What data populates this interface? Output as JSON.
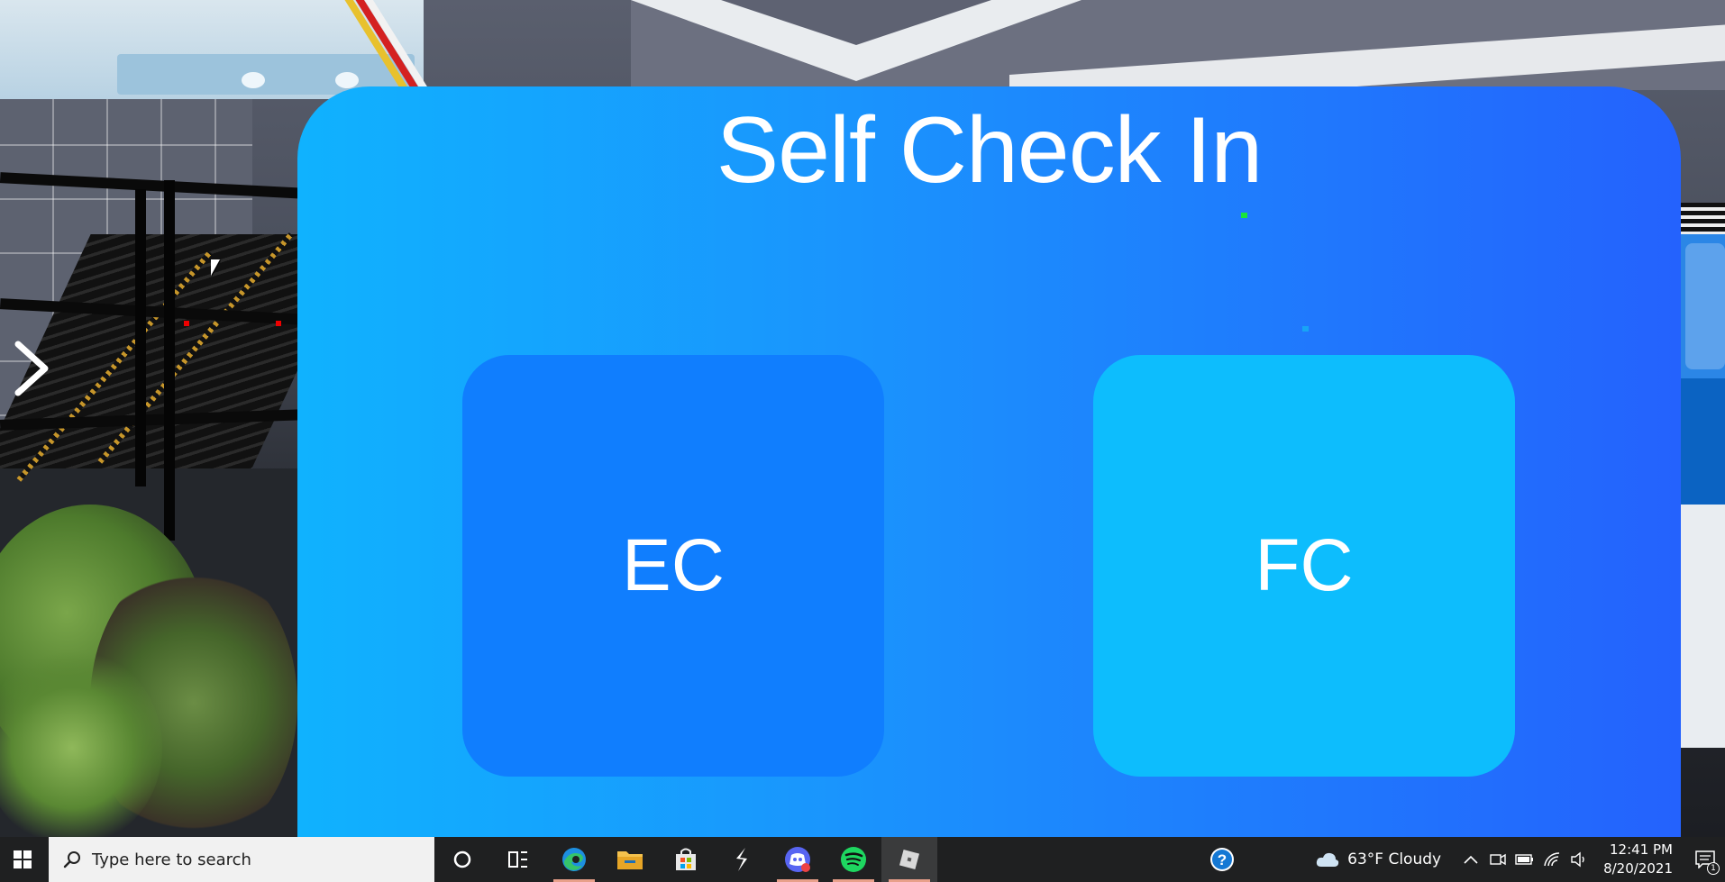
{
  "panel": {
    "title": "Self Check In",
    "options": [
      {
        "label": "EC"
      },
      {
        "label": "FC"
      }
    ],
    "colors": {
      "ec_tile": "#107efe",
      "fc_tile": "#0dbdfd",
      "gradient_left": "#10b2fe",
      "gradient_right": "#2462fd"
    }
  },
  "game": {
    "side_arrow_icon": "chevron-right-icon"
  },
  "taskbar": {
    "search_placeholder": "Type here to search",
    "apps": [
      {
        "name": "cortana",
        "icon": "cortana-circle-icon"
      },
      {
        "name": "task-view",
        "icon": "task-view-icon"
      },
      {
        "name": "edge",
        "icon": "edge-icon"
      },
      {
        "name": "file-explorer",
        "icon": "folder-icon"
      },
      {
        "name": "microsoft-store",
        "icon": "store-bag-icon"
      },
      {
        "name": "app-s",
        "icon": "lightning-s-icon"
      },
      {
        "name": "discord",
        "icon": "discord-icon"
      },
      {
        "name": "spotify",
        "icon": "spotify-icon"
      },
      {
        "name": "roblox",
        "icon": "roblox-icon"
      }
    ],
    "weather": "63°F  Cloudy",
    "time": "12:41 PM",
    "date": "8/20/2021",
    "notification_count": "1"
  }
}
